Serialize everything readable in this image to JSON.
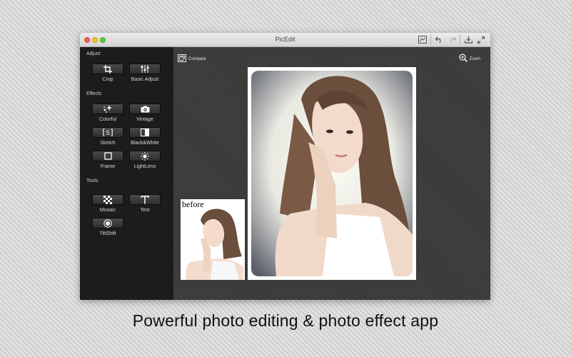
{
  "window": {
    "title": "PicEdit",
    "toolbar_icons": [
      "compare-doc-icon",
      "undo-icon",
      "redo-icon",
      "export-icon",
      "fullscreen-icon"
    ]
  },
  "sidebar": {
    "sections": [
      {
        "title": "Adjust",
        "tools": [
          {
            "label": "Crop",
            "icon": "crop-icon"
          },
          {
            "label": "Basic Adjust",
            "icon": "sliders-icon"
          }
        ]
      },
      {
        "title": "Effects",
        "tools": [
          {
            "label": "Colorful",
            "icon": "sparkle-icon"
          },
          {
            "label": "Vintage",
            "icon": "camera-icon"
          },
          {
            "label": "Sketch",
            "icon": "sketch-icon"
          },
          {
            "label": "Black&White",
            "icon": "black-white-icon"
          },
          {
            "label": "Frame",
            "icon": "frame-icon"
          },
          {
            "label": "LightLens",
            "icon": "sun-icon"
          }
        ]
      },
      {
        "title": "Tools",
        "tools": [
          {
            "label": "Mosaic",
            "icon": "mosaic-icon"
          },
          {
            "label": "Text",
            "icon": "text-icon"
          },
          {
            "label": "TiltShift",
            "icon": "tiltshift-icon"
          }
        ]
      }
    ]
  },
  "canvas": {
    "compare_label": "Compare",
    "zoom_label": "Zoom",
    "before_label": "before"
  },
  "caption": "Powerful photo editing & photo effect app",
  "colors": {
    "sidebar_bg": "#1c1c1c",
    "canvas_bg": "#3b3b3b",
    "button_bg": "#3a3a3a"
  }
}
